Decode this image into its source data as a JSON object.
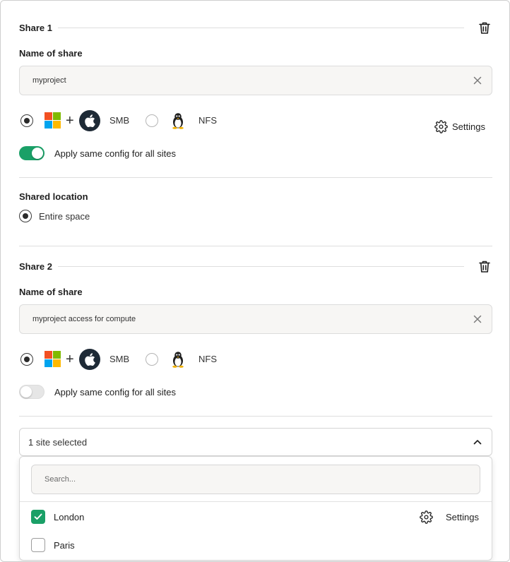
{
  "colors": {
    "accent_green": "#1aa067",
    "ms_red": "#f25022",
    "ms_green": "#7fba00",
    "ms_blue": "#00a4ef",
    "ms_yellow": "#ffb900",
    "apple_bg": "#1e2a36"
  },
  "shares": [
    {
      "title": "Share 1",
      "name_label": "Name of share",
      "name_value": "myproject",
      "protocol_smb": "SMB",
      "protocol_nfs": "NFS",
      "selected_protocol": "SMB",
      "settings_label": "Settings",
      "apply_same_label": "Apply same config for all sites",
      "apply_same": true,
      "shared_location_label": "Shared location",
      "location_option": "Entire space"
    },
    {
      "title": "Share 2",
      "name_label": "Name of share",
      "name_value": "myproject access for compute",
      "protocol_smb": "SMB",
      "protocol_nfs": "NFS",
      "selected_protocol": "SMB",
      "apply_same_label": "Apply same config for all sites",
      "apply_same": false,
      "sites_select": {
        "value": "1 site selected",
        "search_placeholder": "Search...",
        "items": [
          {
            "label": "London",
            "checked": true,
            "settings_label": "Settings"
          },
          {
            "label": "Paris",
            "checked": false
          }
        ]
      }
    }
  ],
  "icons": {
    "trash": "trash-icon",
    "clear": "close-icon",
    "settings": "gear-icon",
    "windows": "windows-logo-icon",
    "apple": "apple-logo-icon",
    "linux": "linux-tux-icon",
    "chevron": "chevron-up-icon",
    "check": "check-icon"
  }
}
